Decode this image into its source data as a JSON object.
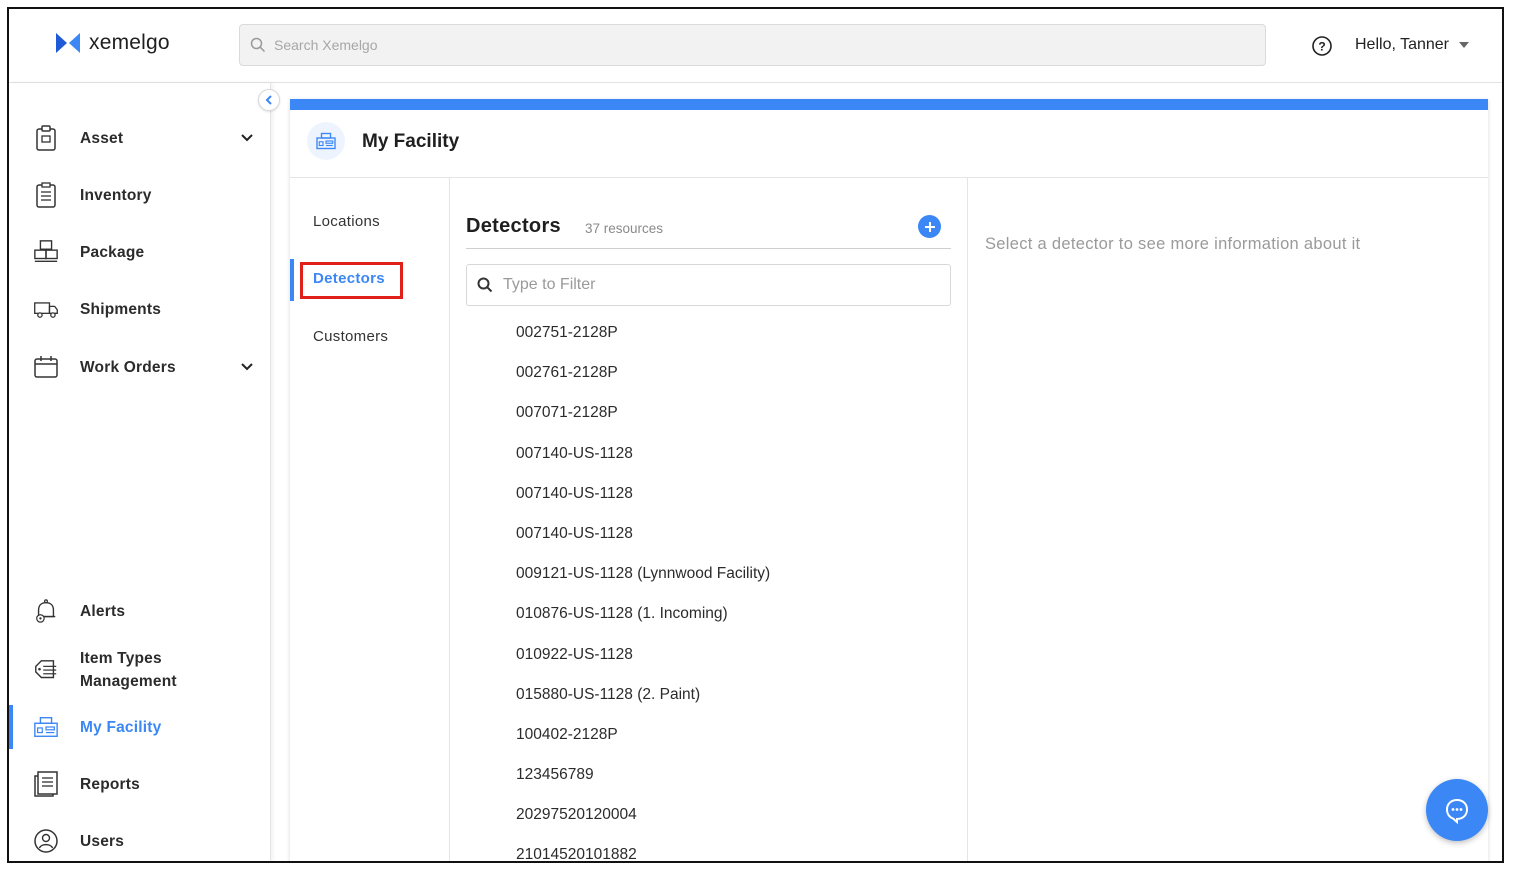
{
  "header": {
    "logo_text": "xemelgo",
    "search_placeholder": "Search Xemelgo",
    "greeting": "Hello, Tanner"
  },
  "sidebar": {
    "items": [
      {
        "label": "Asset",
        "icon": "clipboard-tag-icon",
        "expandable": true
      },
      {
        "label": "Inventory",
        "icon": "checklist-icon",
        "expandable": false
      },
      {
        "label": "Package",
        "icon": "boxes-icon",
        "expandable": false
      },
      {
        "label": "Shipments",
        "icon": "truck-icon",
        "expandable": false
      },
      {
        "label": "Work Orders",
        "icon": "calendar-icon",
        "expandable": true
      },
      {
        "label": "Alerts",
        "icon": "bell-gear-icon",
        "expandable": false
      },
      {
        "label": "Item Types Management",
        "label_line1": "Item Types",
        "label_line2": "Management",
        "icon": "tag-list-icon",
        "expandable": false
      },
      {
        "label": "My Facility",
        "icon": "facility-icon",
        "expandable": false,
        "active": true
      },
      {
        "label": "Reports",
        "icon": "report-icon",
        "expandable": false
      },
      {
        "label": "Users",
        "icon": "user-circle-icon",
        "expandable": false
      }
    ]
  },
  "main": {
    "title": "My Facility",
    "subnav": [
      {
        "label": "Locations"
      },
      {
        "label": "Detectors",
        "active": true
      },
      {
        "label": "Customers"
      }
    ],
    "list": {
      "title": "Detectors",
      "count": "37 resources",
      "filter_placeholder": "Type to Filter",
      "items": [
        "002751-2128P",
        "002761-2128P",
        "007071-2128P",
        "007140-US-1128",
        "007140-US-1128",
        "007140-US-1128",
        "009121-US-1128 (Lynnwood Facility)",
        "010876-US-1128 (1. Incoming)",
        "010922-US-1128",
        "015880-US-1128 (2. Paint)",
        "100402-2128P",
        "123456789",
        "20297520120004",
        "21014520101882"
      ]
    },
    "detail_message": "Select a detector to see more information about it"
  },
  "colors": {
    "accent": "#3b87f5",
    "highlight_box": "#e0201b"
  }
}
